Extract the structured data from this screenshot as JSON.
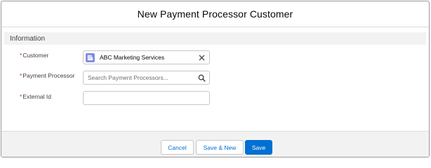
{
  "modal": {
    "title": "New Payment Processor Customer"
  },
  "section": {
    "title": "Information"
  },
  "fields": {
    "customer": {
      "label": "Customer",
      "required_marker": "*",
      "value": "ABC Marketing Services",
      "clear_icon": "close-icon",
      "record_icon": "account-icon"
    },
    "payment_processor": {
      "label": "Payment Processor",
      "required_marker": "*",
      "placeholder": "Search Payment Processors...",
      "icon": "search-icon"
    },
    "external_id": {
      "label": "External Id",
      "required_marker": "*",
      "value": ""
    }
  },
  "footer": {
    "cancel_label": "Cancel",
    "save_new_label": "Save & New",
    "save_label": "Save"
  },
  "colors": {
    "brand": "#0070d2",
    "required": "#c23934",
    "record_icon_bg": "#7f8de1",
    "section_bg": "#f3f2f2"
  }
}
